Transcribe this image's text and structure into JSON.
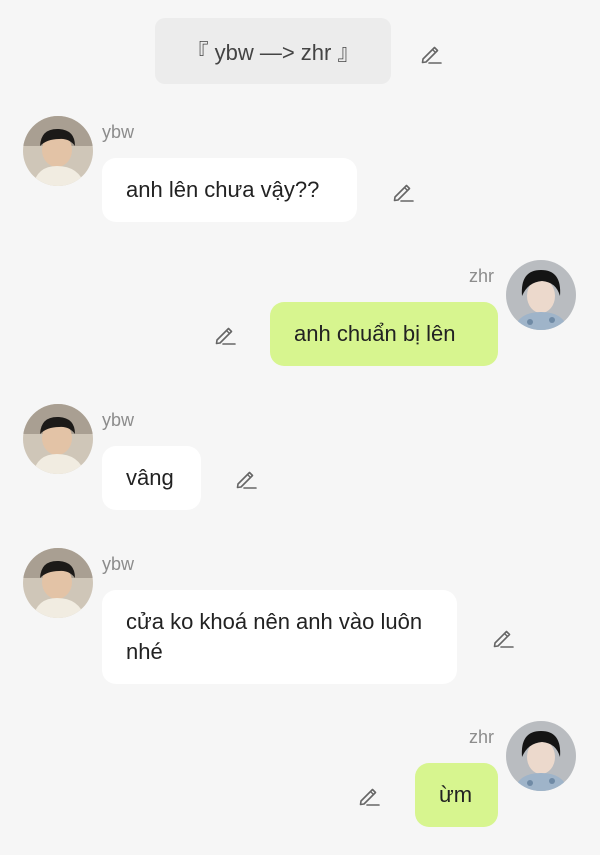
{
  "header": {
    "title": "『 ybw —> zhr 』"
  },
  "messages": [
    {
      "sender": "ybw",
      "side": "left",
      "text": "anh lên chưa vậy??"
    },
    {
      "sender": "zhr",
      "side": "right",
      "text": "anh chuẩn bị lên"
    },
    {
      "sender": "ybw",
      "side": "left",
      "text": "vâng"
    },
    {
      "sender": "ybw",
      "side": "left",
      "text": "cửa ko khoá nên anh vào luôn nhé"
    },
    {
      "sender": "zhr",
      "side": "right",
      "text": "ừm"
    }
  ],
  "icons": {
    "edit": "pencil-edit-icon",
    "avatar_ybw": "avatar-ybw",
    "avatar_zhr": "avatar-zhr"
  },
  "colors": {
    "background": "#f6f6f6",
    "header_bg": "#ececec",
    "left_bubble": "#ffffff",
    "right_bubble": "#d7f58f",
    "name_text": "#8c8c8c"
  }
}
